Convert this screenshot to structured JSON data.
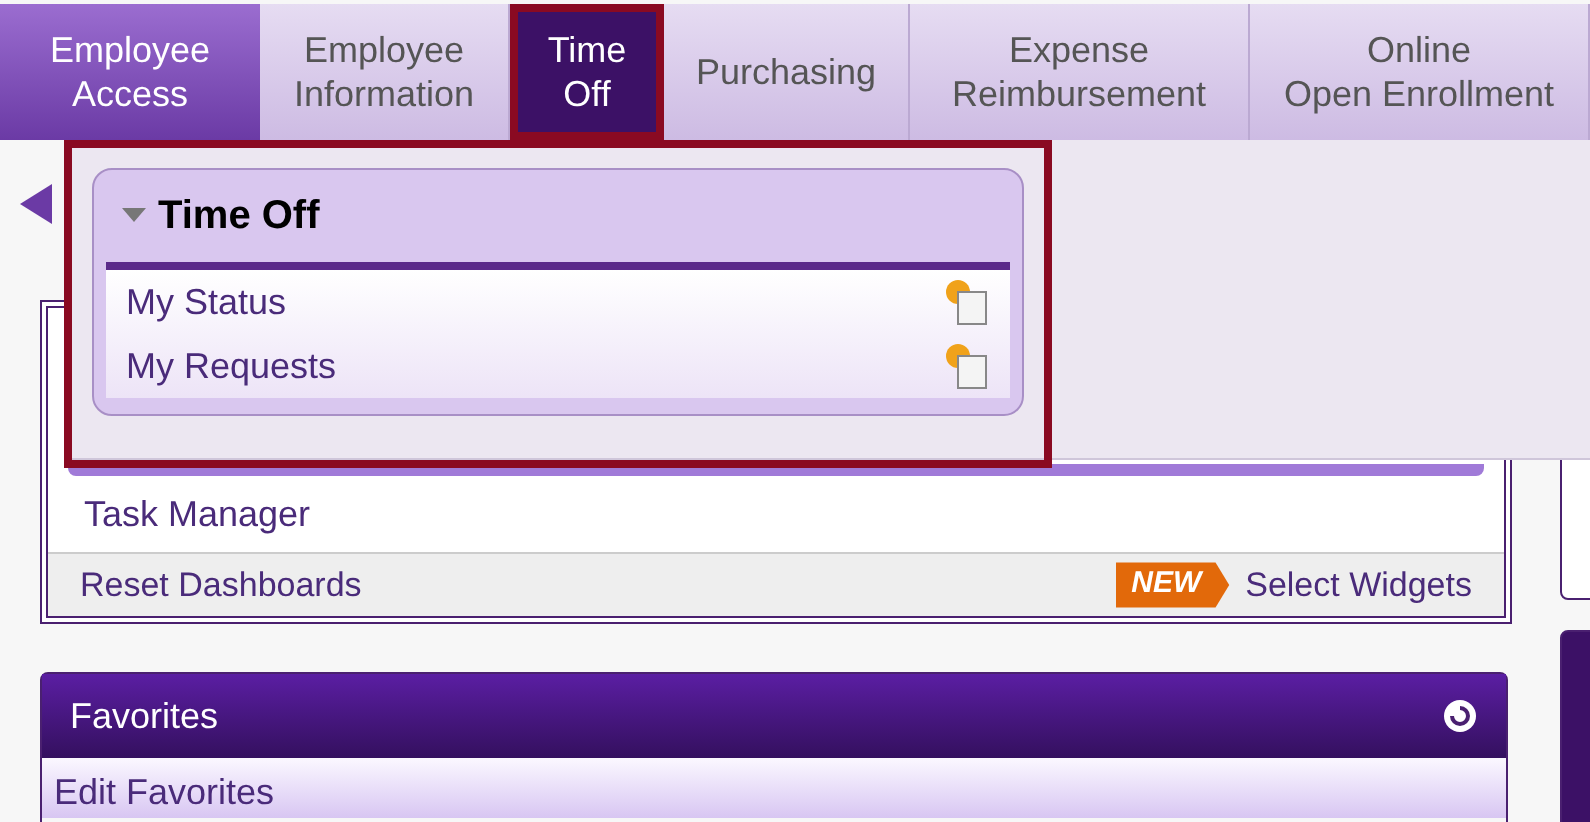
{
  "tabs": [
    {
      "label": "Employee Access",
      "kind": "section",
      "selected": false
    },
    {
      "label": "Employee Information",
      "kind": "tab",
      "selected": false
    },
    {
      "label": "Time Off",
      "kind": "tab",
      "selected": true
    },
    {
      "label": "Purchasing",
      "kind": "tab",
      "selected": false
    },
    {
      "label": "Expense Reimbursement",
      "kind": "tab",
      "selected": false
    },
    {
      "label": "Online Open Enrollment",
      "kind": "tab",
      "selected": false
    }
  ],
  "dropdown": {
    "title": "Time Off",
    "expanded": true,
    "items": [
      {
        "label": "My Status"
      },
      {
        "label": "My Requests"
      }
    ]
  },
  "dashboard": {
    "items": [
      "Task Manager"
    ],
    "reset": "Reset Dashboards",
    "badge": "NEW",
    "select": "Select Widgets"
  },
  "favorites": {
    "title": "Favorites",
    "items": [
      "Edit Favorites"
    ]
  }
}
